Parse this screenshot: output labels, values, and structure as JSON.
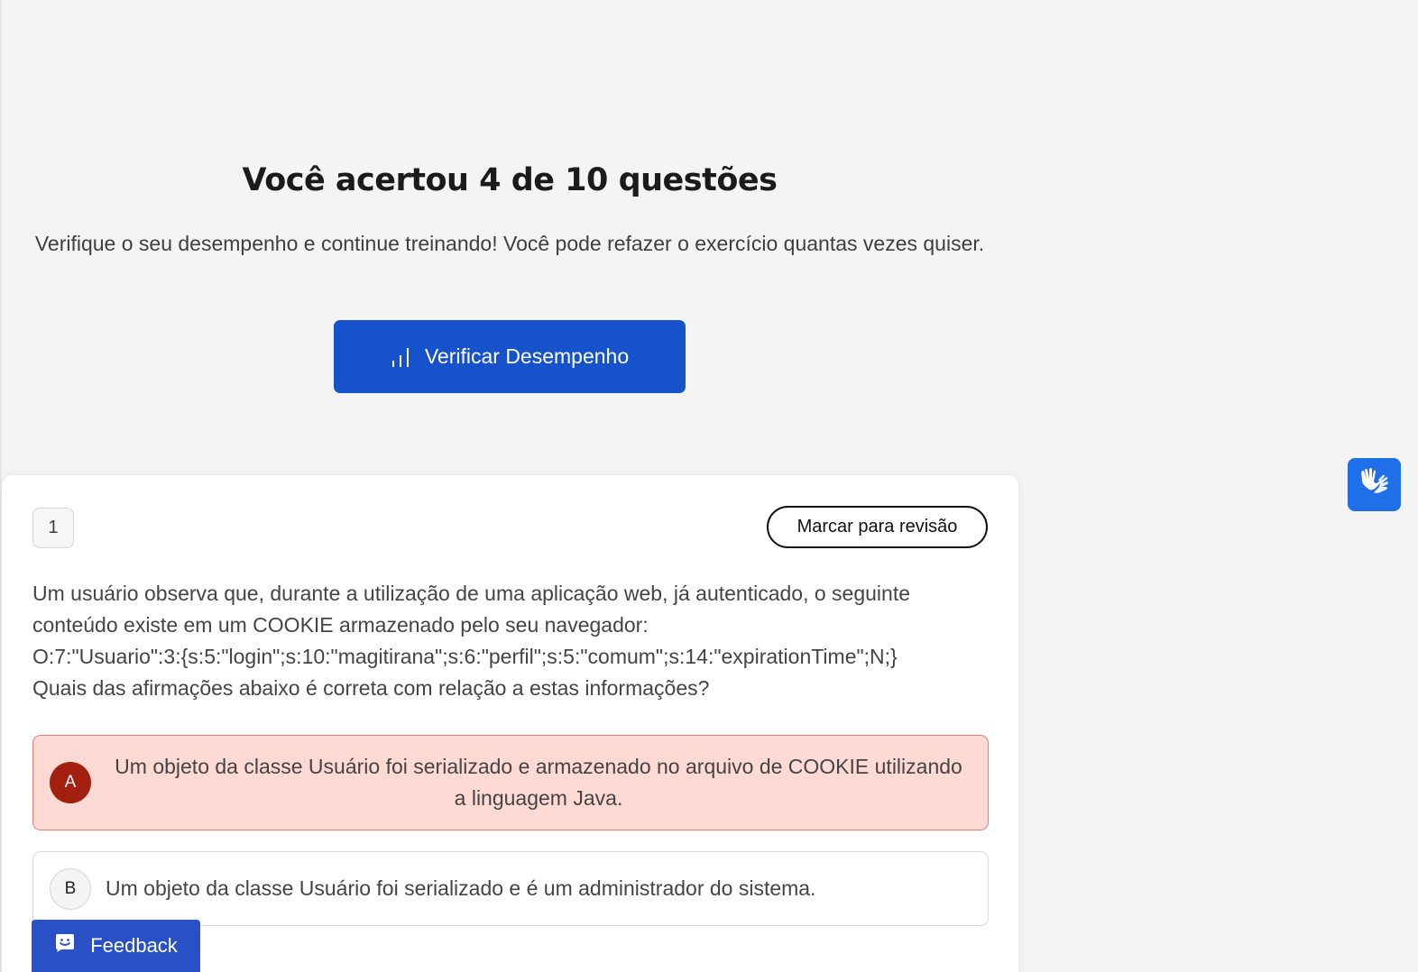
{
  "result": {
    "title": "Você acertou 4 de 10 questões",
    "subtitle": "Verifique o seu desempenho e continue treinando! Você pode refazer o exercício quantas vezes quiser.",
    "button_label": "Verificar Desempenho",
    "button_icon": "bar-chart-icon",
    "button_color": "#1652cc"
  },
  "question": {
    "number": "1",
    "review_label": "Marcar para revisão",
    "text_lines": [
      "Um usuário observa que, durante a utilização de uma aplicação web, já autenticado, o seguinte",
      "conteúdo existe em um COOKIE armazenado pelo seu navegador:",
      "O:7:\"Usuario\":3:{s:5:\"login\";s:10:\"magitirana\";s:6:\"perfil\";s:5:\"comum\";s:14:\"expirationTime\";N;}",
      "Quais das afirmações abaixo é correta com relação a estas informações?"
    ],
    "options": [
      {
        "letter": "A",
        "text": "Um objeto da classe Usuário foi serializado e armazenado no arquivo de COOKIE utilizando a linguagem Java.",
        "state": "incorrect",
        "color": "#a3200e"
      },
      {
        "letter": "B",
        "text": "Um objeto da classe Usuário foi serializado e é um administrador do sistema.",
        "state": "neutral"
      }
    ]
  },
  "feedback": {
    "label": "Feedback",
    "icon": "smile-box-icon",
    "color": "#2a50c5"
  },
  "accessibility": {
    "icon": "sign-language-hands-icon",
    "color": "#1f6fe8"
  }
}
